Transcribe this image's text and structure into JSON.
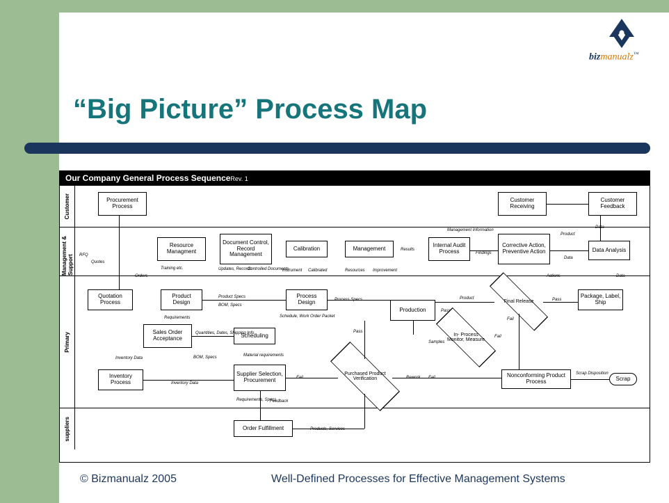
{
  "logo": {
    "biz": "biz",
    "manualz": "manualz",
    "tm": "™"
  },
  "title": "“Big Picture” Process Map",
  "diagram": {
    "header": "Our Company General Process Sequence",
    "rev": "Rev. 1",
    "lanes": {
      "customer": "Customer",
      "mgmt": "Management & Support",
      "primary": "Primary",
      "suppliers": "suppliers"
    },
    "boxes": {
      "procurement": "Procurement Process",
      "cust_recv": "Customer Receiving",
      "cust_feedback": "Customer Feedback",
      "resource": "Resource Managment",
      "doc_control": "Document Control, Record Management",
      "calibration": "Calibration",
      "management": "Management",
      "internal_audit": "Internal Audit Process",
      "corrective": "Corrective Action, Preventive Action",
      "data_analysis": "Data Analysis",
      "quotation": "Quotation Process",
      "product_design": "Product Design",
      "process_design": "Process Design",
      "production": "Production",
      "final_release": "Final Release",
      "package": "Package, Label, Ship",
      "sales_order": "Sales Order Acceptance",
      "scheduling": "Scheduling",
      "inprocess": "In- Process Monitor, Measure",
      "inventory": "Inventory Process",
      "supplier_sel": "Supplier Selection, Procurement",
      "purchased_verif": "Purchased Product Verification",
      "nonconforming": "Nonconforming Product Process",
      "scrap": "Scrap",
      "order_fulfill": "Order Fulfillment"
    },
    "labels": {
      "rfq": "RFQ",
      "quotes": "Quotes",
      "orders": "Orders",
      "training": "Training etc.",
      "updates": "Updates, Records",
      "controlled": "Controlled Documents",
      "instrument": "Instrument",
      "calibrated": "Calibrated",
      "resources": "Resources",
      "improvement": "Improvement",
      "mgmt_info": "Management Information",
      "results": "Results",
      "findings": "Findings",
      "product": "Product",
      "data": "Data",
      "actions": "Actions",
      "product_specs": "Product Specs",
      "bom_specs": "BOM, Specs",
      "requirements": "Requirements",
      "process_specs": "Process Specs",
      "schedule_wop": "Schedule, Work Order Packet",
      "quantities": "Quantities, Dates, Shipping Info.",
      "material_req": "Material requirements",
      "inventory_data": "Inventory Data",
      "inventory_data2": "Inventory Data",
      "req_specs": "Requirements, Specs",
      "feedback": "Feedback",
      "fail": "Fail",
      "pass": "Pass",
      "samples": "Samples",
      "rework": "Rework",
      "scrap_disp": "Scrap Disposition",
      "products_services": "Products, Services"
    }
  },
  "footer": {
    "left": "© Bizmanualz 2005",
    "right": "Well-Defined Processes for Effective Management Systems"
  }
}
